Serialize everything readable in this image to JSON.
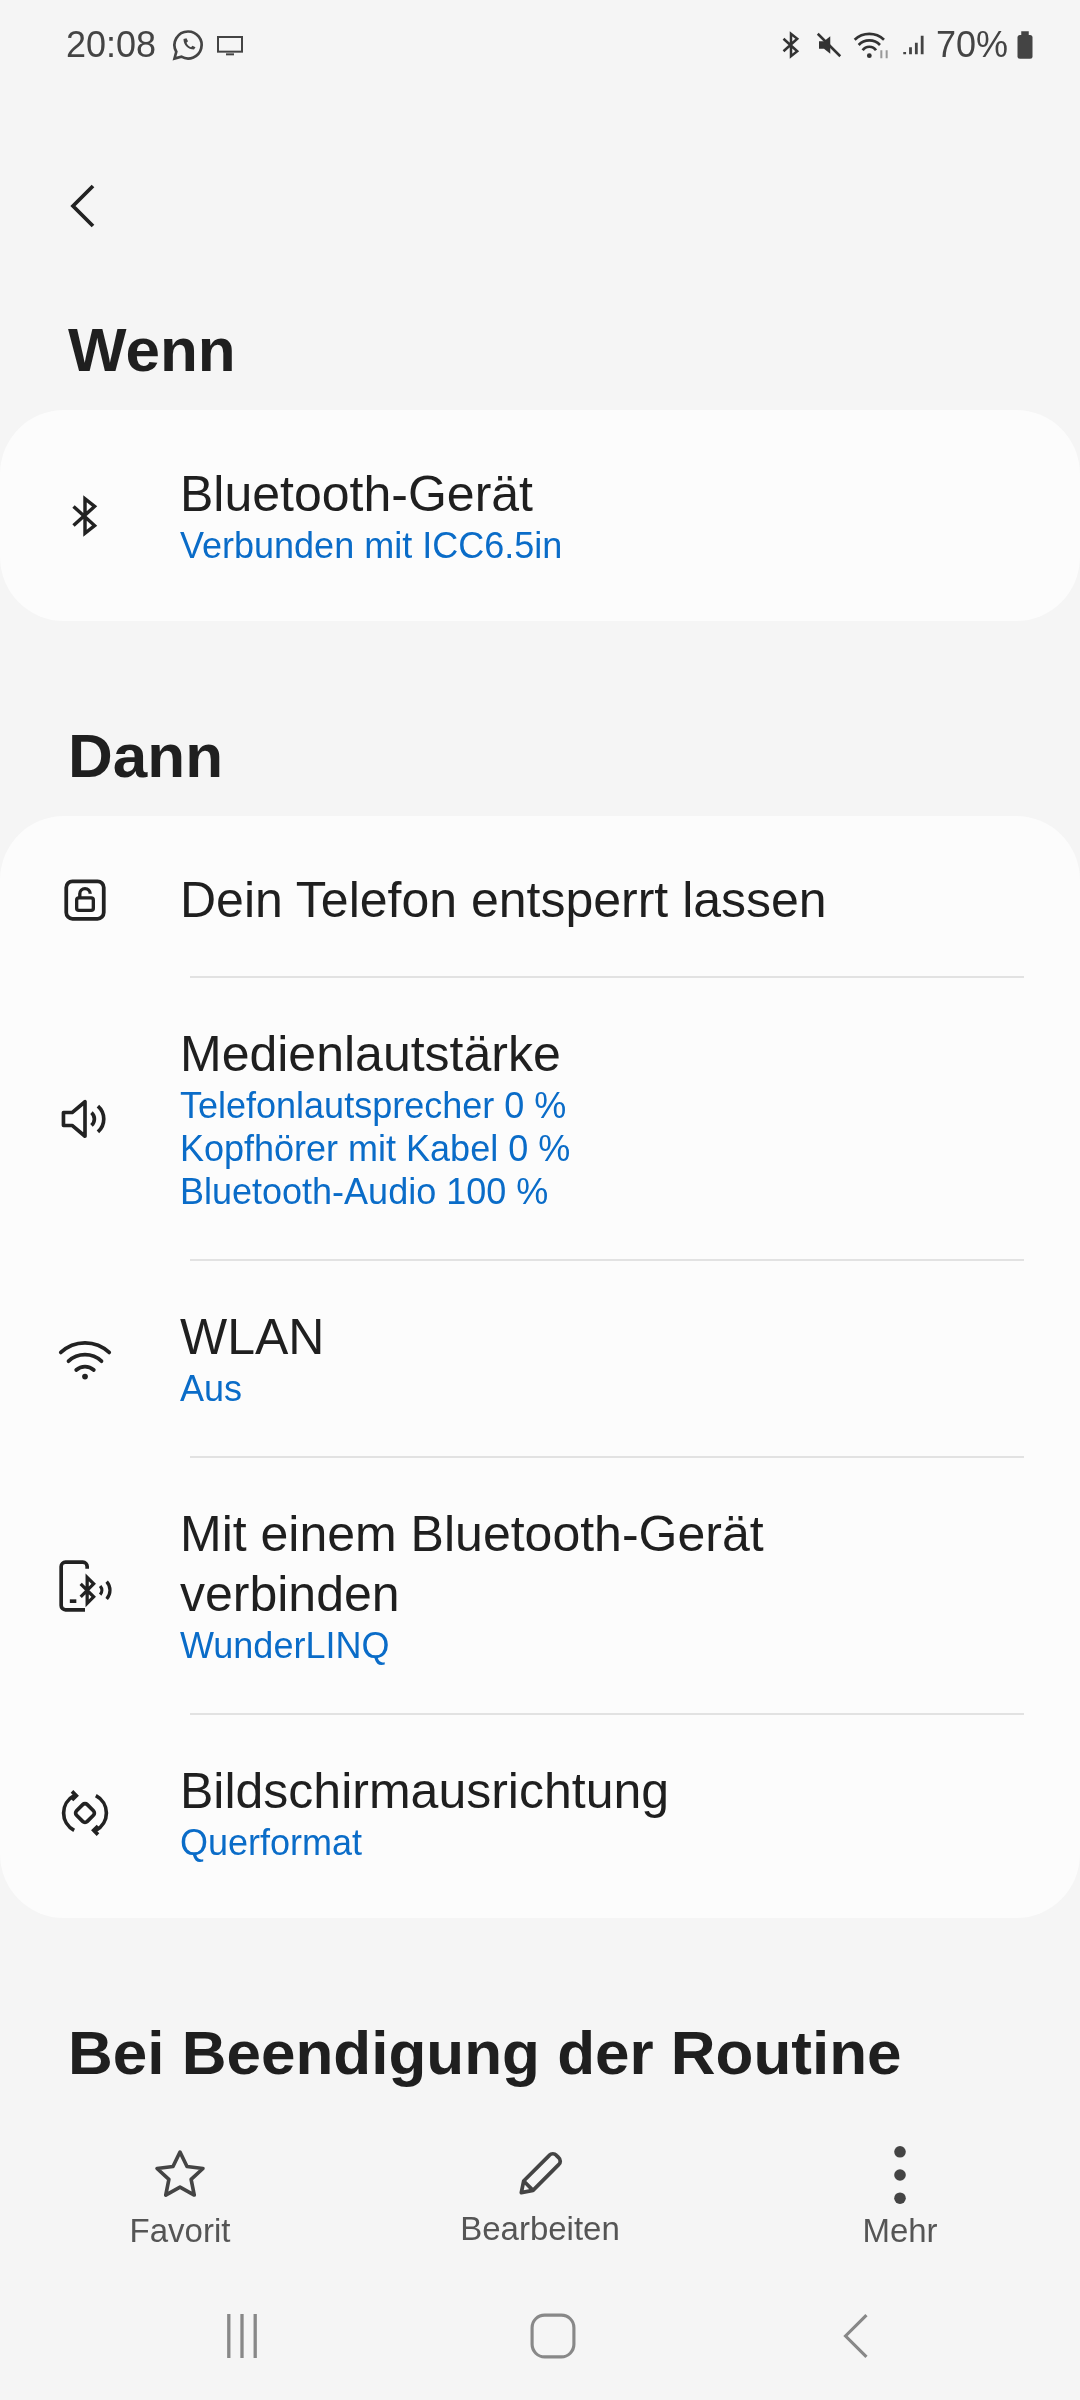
{
  "status_bar": {
    "time": "20:08",
    "battery": "70%"
  },
  "sections": [
    {
      "title": "Wenn",
      "items": [
        {
          "kind": "bluetooth",
          "title": "Bluetooth-Gerät",
          "details": [
            "Verbunden mit ICC6.5in"
          ]
        }
      ]
    },
    {
      "title": "Dann",
      "items": [
        {
          "kind": "lock",
          "title": "Dein Telefon entsperrt lassen"
        },
        {
          "kind": "volume",
          "title": "Medienlautstärke",
          "details": [
            "Telefonlautsprecher 0 %",
            "Kopfhörer mit Kabel 0 %",
            "Bluetooth-Audio 100 %"
          ]
        },
        {
          "kind": "wifi",
          "title": "WLAN",
          "details": [
            "Aus"
          ]
        },
        {
          "kind": "phone-bluetooth",
          "title": "Mit einem Bluetooth-Gerät verbinden",
          "details": [
            "WunderLINQ"
          ]
        },
        {
          "kind": "rotate",
          "title": "Bildschirmausrichtung",
          "details": [
            "Querformat"
          ]
        }
      ]
    }
  ],
  "next_heading": "Bei Beendigung der Routine",
  "actions": [
    {
      "kind": "star",
      "label": "Favorit"
    },
    {
      "kind": "pencil",
      "label": "Bearbeiten"
    },
    {
      "kind": "more",
      "label": "Mehr"
    }
  ]
}
